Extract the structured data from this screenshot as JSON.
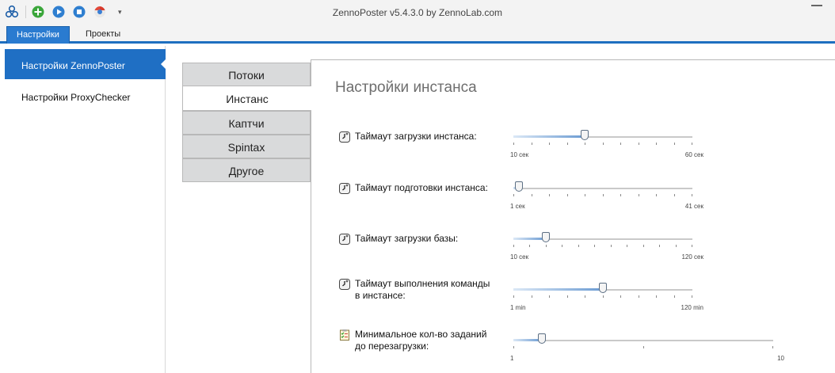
{
  "app": {
    "title": "ZennoPoster v5.4.3.0 by ZennoLab.com"
  },
  "quick_access": {
    "icons": [
      "app-logo-icon",
      "add-icon",
      "play-icon",
      "stop-icon",
      "chrome-icon",
      "dropdown-icon"
    ],
    "dropdown_glyph": "▾"
  },
  "ribbon_tabs": [
    {
      "label": "Настройки",
      "active": true
    },
    {
      "label": "Проекты",
      "active": false
    }
  ],
  "sidebar": {
    "items": [
      {
        "label": "Настройки ZennoPoster",
        "active": true
      },
      {
        "label": "Настройки ProxyChecker",
        "active": false
      }
    ]
  },
  "settings_tabs": [
    {
      "label": "Потоки",
      "active": false
    },
    {
      "label": "Инстанс",
      "active": true
    },
    {
      "label": "Каптчи",
      "active": false
    },
    {
      "label": "Spintax",
      "active": false
    },
    {
      "label": "Другое",
      "active": false
    }
  ],
  "panel": {
    "title": "Настройки инстанса",
    "settings": [
      {
        "label_lines": [
          "Таймаут загрузки инстанса:"
        ],
        "icon": "clock-icon",
        "min_label": "10 сек",
        "max_label": "60 сек",
        "value": 0.4,
        "ticks": 11
      },
      {
        "label_lines": [
          "Таймаут подготовки инстанса:"
        ],
        "icon": "clock-icon",
        "min_label": "1 сек",
        "max_label": "41 сек",
        "value": 0.03,
        "ticks": 11
      },
      {
        "label_lines": [
          "Таймаут загрузки базы:"
        ],
        "icon": "clock-icon",
        "min_label": "10 сек",
        "max_label": "120 сек",
        "value": 0.18,
        "ticks": 12
      },
      {
        "label_lines": [
          "Таймаут выполнения команды",
          "в инстансе:"
        ],
        "icon": "clock-icon",
        "min_label": "1 min",
        "max_label": "120 min",
        "value": 0.5,
        "ticks": 11
      },
      {
        "label_lines": [
          "Минимальное кол-во заданий",
          "до перезагрузки:"
        ],
        "icon": "checklist-icon",
        "min_label": "1",
        "max_label": "10",
        "value": 0.11,
        "ticks": 3
      }
    ]
  }
}
